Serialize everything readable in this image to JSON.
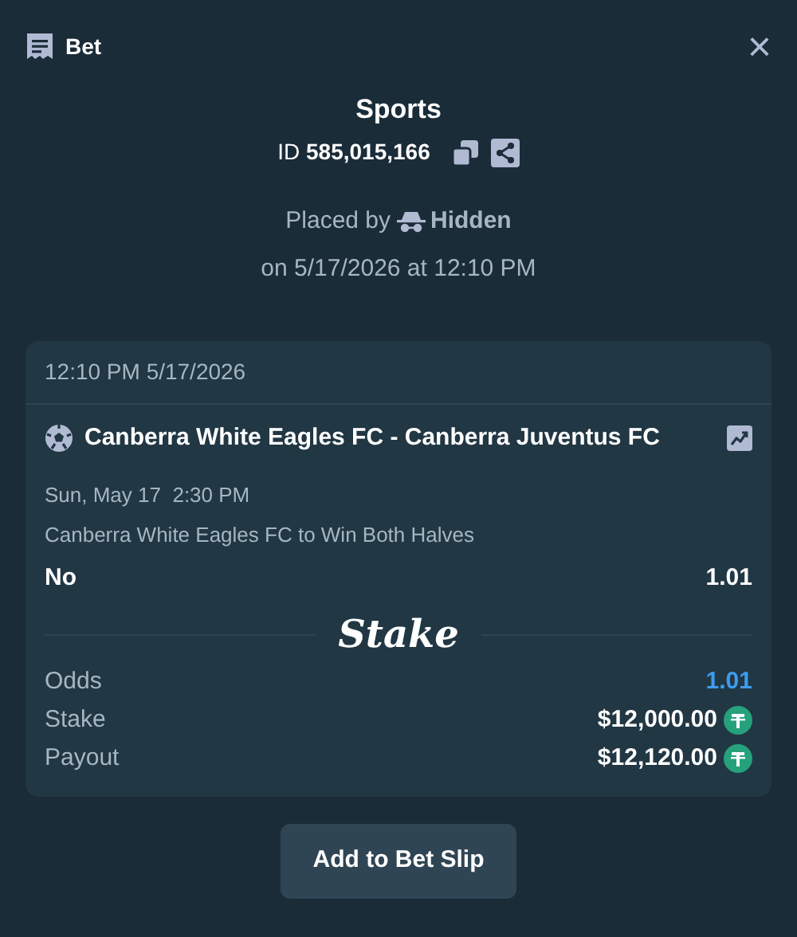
{
  "header": {
    "title": "Bet",
    "close": "×"
  },
  "summary": {
    "category": "Sports",
    "id_label": "ID",
    "id_value": "585,015,166",
    "placed_by_label": "Placed by",
    "placed_by_user": "Hidden",
    "placed_on": "on 5/17/2026 at 12:10 PM"
  },
  "bet_card": {
    "timestamp": "12:10 PM 5/17/2026",
    "event": "Canberra White Eagles FC - Canberra Juventus FC",
    "event_time": "Sun, May 17  2:30 PM",
    "market": "Canberra White Eagles FC to Win Both Halves",
    "outcome": "No",
    "outcome_odds": "1.01",
    "logo": "Stake",
    "totals": [
      {
        "kind": "odds",
        "label": "Odds",
        "value": "1.01"
      },
      {
        "kind": "amount",
        "label": "Stake",
        "value": "$12,000.00"
      },
      {
        "kind": "amount",
        "label": "Payout",
        "value": "$12,120.00"
      }
    ]
  },
  "buttons": [
    "Add to Bet Slip"
  ]
}
